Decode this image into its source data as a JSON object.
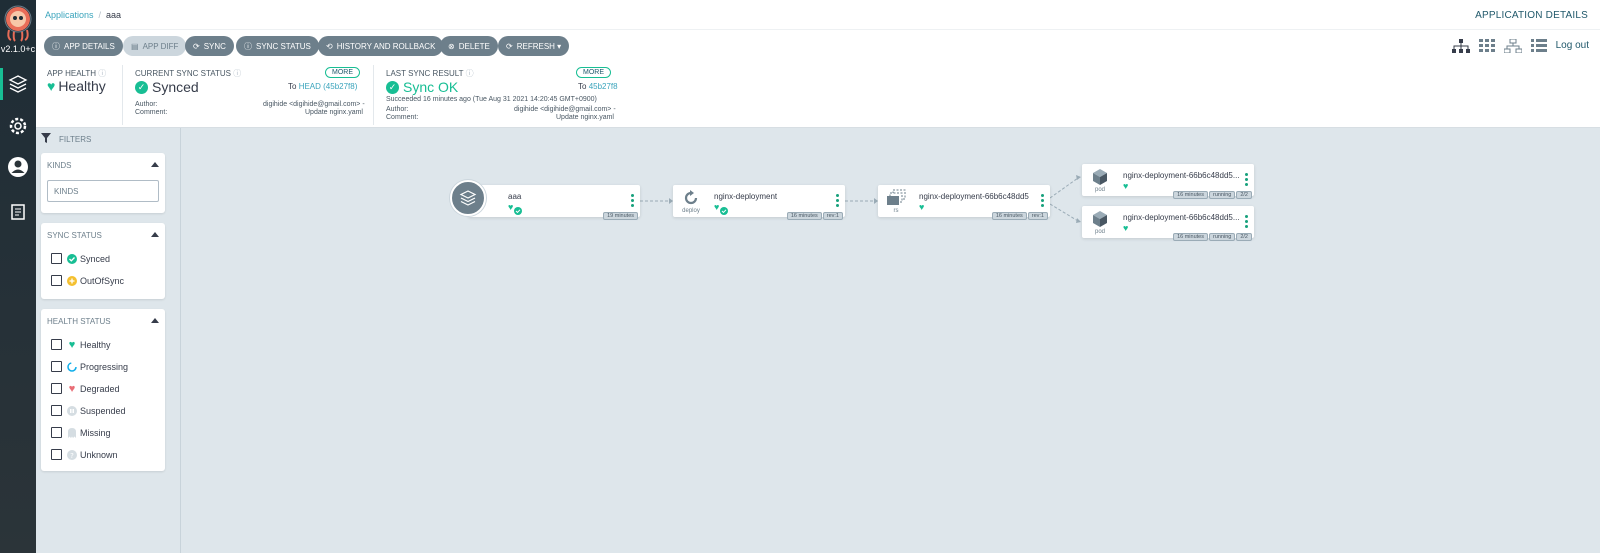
{
  "nav": {
    "version": "v2.1.0+c"
  },
  "breadcrumb": {
    "root": "Applications",
    "current": "aaa"
  },
  "header": {
    "title": "APPLICATION DETAILS",
    "logout": "Log out"
  },
  "toolbar": {
    "app_details": "APP DETAILS",
    "app_diff": "APP DIFF",
    "sync": "SYNC",
    "sync_status": "SYNC STATUS",
    "history": "HISTORY AND ROLLBACK",
    "delete": "DELETE",
    "refresh": "REFRESH ▾"
  },
  "status": {
    "health": {
      "title": "APP HEALTH",
      "value": "Healthy"
    },
    "current_sync": {
      "title": "CURRENT SYNC STATUS",
      "more": "MORE",
      "value": "Synced",
      "to_prefix": "To",
      "to_ref": "HEAD (45b27f8)",
      "author_label": "Author:",
      "author": "digihide <digihide@gmail.com> -",
      "comment_label": "Comment:",
      "comment": "Update nginx.yaml"
    },
    "last_sync": {
      "title": "LAST SYNC RESULT",
      "more": "MORE",
      "value": "Sync OK",
      "to_prefix": "To",
      "to_ref": "45b27f8",
      "succeeded": "Succeeded 16 minutes ago (Tue Aug 31 2021 14:20:45 GMT+0900)",
      "author_label": "Author:",
      "author": "digihide <digihide@gmail.com> -",
      "comment_label": "Comment:",
      "comment": "Update nginx.yaml"
    }
  },
  "filters": {
    "header": "FILTERS",
    "kinds": {
      "title": "KINDS",
      "placeholder": "KINDS"
    },
    "sync_status": {
      "title": "SYNC STATUS",
      "items": [
        "Synced",
        "OutOfSync"
      ]
    },
    "health_status": {
      "title": "HEALTH STATUS",
      "items": [
        "Healthy",
        "Progressing",
        "Degraded",
        "Suspended",
        "Missing",
        "Unknown"
      ]
    }
  },
  "graph": {
    "app": {
      "name": "aaa",
      "age": "19 minutes"
    },
    "deploy": {
      "name": "nginx-deployment",
      "kind": "deploy",
      "age": "16 minutes",
      "rev": "rev:1"
    },
    "rs": {
      "name": "nginx-deployment-66b6c48dd5",
      "kind": "rs",
      "age": "16 minutes",
      "rev": "rev:1"
    },
    "pods": [
      {
        "name": "nginx-deployment-66b6c48dd5...",
        "kind": "pod",
        "age": "16 minutes",
        "state": "running",
        "ready": "2/2"
      },
      {
        "name": "nginx-deployment-66b6c48dd5...",
        "kind": "pod",
        "age": "16 minutes",
        "state": "running",
        "ready": "2/2"
      }
    ]
  },
  "colors": {
    "accent": "#18be94",
    "button": "#6d7f8b",
    "background": "#dee6eb"
  }
}
